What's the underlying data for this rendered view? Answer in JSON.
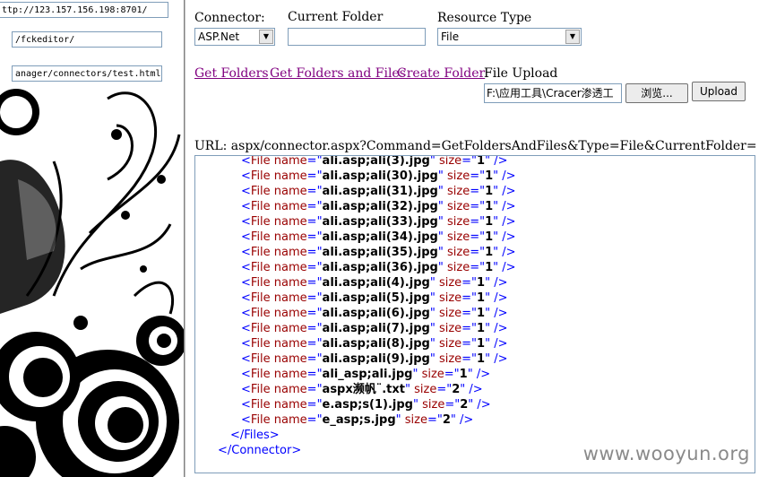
{
  "left_frame": {
    "address_fields": [
      "ttp://123.157.156.198:8701/",
      "/fckeditor/",
      "anager/connectors/test.html"
    ]
  },
  "form": {
    "connector": {
      "label": "Connector:",
      "value": "ASP.Net"
    },
    "current_folder": {
      "label": "Current Folder",
      "value": ""
    },
    "resource_type": {
      "label": "Resource Type",
      "value": "File"
    },
    "links": [
      "Get Folders",
      "Get Folders and Files",
      "Create Folder"
    ],
    "file_upload": {
      "label": "File Upload",
      "path": "F:\\应用工具\\Cracer渗透工",
      "browse_label": "浏览...",
      "upload_label": "Upload"
    }
  },
  "request": {
    "url_text": "URL: aspx/connector.aspx?Command=GetFoldersAndFiles&Type=File&CurrentFolder="
  },
  "xml": {
    "files": [
      {
        "name": "ali.asp;ali(3).jpg",
        "size": "1"
      },
      {
        "name": "ali.asp;ali(30).jpg",
        "size": "1"
      },
      {
        "name": "ali.asp;ali(31).jpg",
        "size": "1"
      },
      {
        "name": "ali.asp;ali(32).jpg",
        "size": "1"
      },
      {
        "name": "ali.asp;ali(33).jpg",
        "size": "1"
      },
      {
        "name": "ali.asp;ali(34).jpg",
        "size": "1"
      },
      {
        "name": "ali.asp;ali(35).jpg",
        "size": "1"
      },
      {
        "name": "ali.asp;ali(36).jpg",
        "size": "1"
      },
      {
        "name": "ali.asp;ali(4).jpg",
        "size": "1"
      },
      {
        "name": "ali.asp;ali(5).jpg",
        "size": "1"
      },
      {
        "name": "ali.asp;ali(6).jpg",
        "size": "1"
      },
      {
        "name": "ali.asp;ali(7).jpg",
        "size": "1"
      },
      {
        "name": "ali.asp;ali(8).jpg",
        "size": "1"
      },
      {
        "name": "ali.asp;ali(9).jpg",
        "size": "1"
      },
      {
        "name": "ali_asp;ali.jpg",
        "size": "1"
      },
      {
        "name": "aspx濒帆¨.txt",
        "size": "2"
      },
      {
        "name": "e.asp;s(1).jpg",
        "size": "2"
      },
      {
        "name": "e_asp;s.jpg",
        "size": "2"
      }
    ],
    "closing_files": "</Files>",
    "closing_connector": "</Connector>"
  },
  "watermark": "www.wooyun.org"
}
